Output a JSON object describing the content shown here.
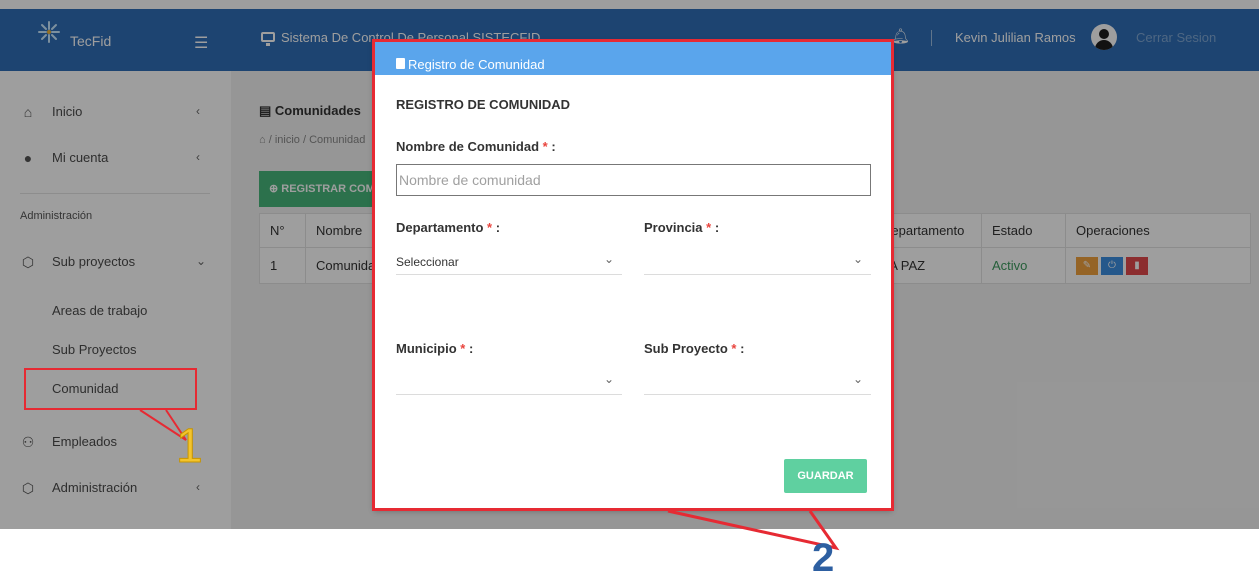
{
  "brand": {
    "name": "TecFid"
  },
  "header": {
    "system_title": "Sistema De Control De Personal SISTECFID",
    "user_name": "Kevin Julilian Ramos",
    "logout": "Cerrar Sesion"
  },
  "sidebar": {
    "inicio": "Inicio",
    "mi_cuenta": "Mi cuenta",
    "section": "Administración",
    "sub_proyectos": "Sub proyectos",
    "sub_items": [
      "Areas de trabajo",
      "Sub Proyectos",
      "Comunidad"
    ],
    "empleados": "Empleados",
    "administracion": "Administración"
  },
  "page": {
    "title": "Comunidades",
    "breadcrumb": "inicio  /  Comunidad",
    "add_button": "REGISTRAR COMUNIDAD",
    "table": {
      "headers": [
        "N°",
        "Nombre",
        "Departamento",
        "Estado",
        "Operaciones"
      ],
      "rows": [
        {
          "n": "1",
          "nombre": "Comunidad",
          "departamento": "LA PAZ",
          "estado": "Activo"
        }
      ]
    }
  },
  "modal": {
    "title": "Registro de Comunidad",
    "section_title": "REGISTRO DE COMUNIDAD",
    "nombre_label": "Nombre de Comunidad",
    "nombre_placeholder": "Nombre de comunidad",
    "departamento_label": "Departamento",
    "departamento_value": "Seleccionar",
    "provincia_label": "Provincia",
    "municipio_label": "Municipio",
    "subproyecto_label": "Sub Proyecto",
    "required_mark": "*",
    "save_button": "GUARDAR"
  },
  "annotations": {
    "step1": "1",
    "step2": "2"
  },
  "colors": {
    "primary": "#2f6fb7",
    "modal_header": "#5aa5ec",
    "success": "#48b77b",
    "danger": "#e62a33"
  }
}
